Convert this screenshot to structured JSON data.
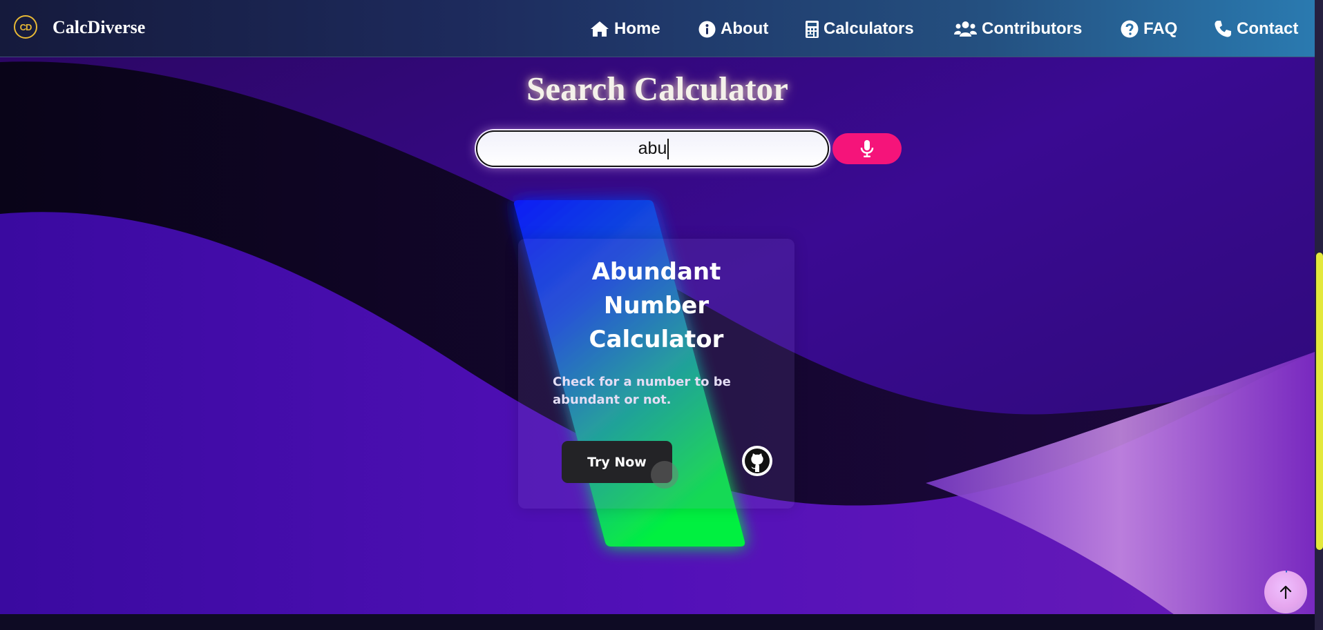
{
  "brand": {
    "logo_text": "CD",
    "name": "CalcDiverse"
  },
  "nav": {
    "items": [
      {
        "label": "Home",
        "icon": "home-icon"
      },
      {
        "label": "About",
        "icon": "info-icon"
      },
      {
        "label": "Calculators",
        "icon": "calculator-icon"
      },
      {
        "label": "Contributors",
        "icon": "users-icon"
      },
      {
        "label": "FAQ",
        "icon": "question-icon"
      },
      {
        "label": "Contact",
        "icon": "phone-icon"
      }
    ]
  },
  "search": {
    "title": "Search Calculator",
    "value": "abu",
    "mic_icon": "microphone-icon"
  },
  "card": {
    "title_lines": [
      "Abundant",
      "Number",
      "Calculator"
    ],
    "description": "Check for a number to be abundant or not.",
    "button_label": "Try Now",
    "github_icon": "github-icon"
  },
  "colors": {
    "mic_button": "#f5147a",
    "scroll_thumb": "#e3e83c",
    "logo_accent": "#e8b935"
  }
}
